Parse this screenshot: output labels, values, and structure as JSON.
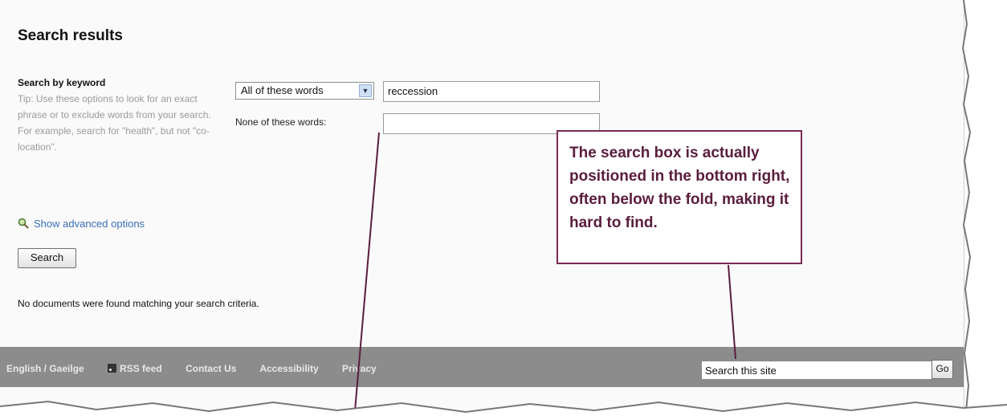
{
  "page": {
    "title": "Search results"
  },
  "keyword": {
    "heading": "Search by keyword",
    "tip": "Tip: Use these options to look for an exact phrase or to exclude words from your search. For example, search for \"health\", but not \"co-location\"."
  },
  "form": {
    "match_select": "All of these words",
    "keyword_value": "reccession",
    "none_label": "None of these words:",
    "none_value": "",
    "advanced_link": "Show advanced options",
    "search_button": "Search"
  },
  "results": {
    "message": "No documents were found matching your search criteria."
  },
  "footer": {
    "links": [
      "English / Gaeilge",
      "RSS feed",
      "Contact Us",
      "Accessibility",
      "Privacy"
    ],
    "site_search_value": "Search this site",
    "go_button": "Go"
  },
  "annotation": {
    "text": "The search box is actually positioned in the bottom right, often below the fold, making it hard to find.",
    "border_color": "#7a2a55"
  }
}
